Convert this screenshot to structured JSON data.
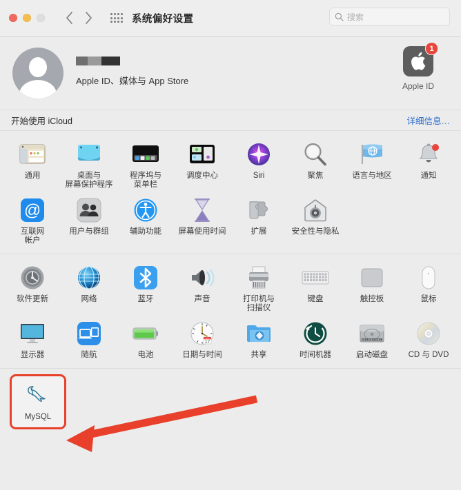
{
  "window": {
    "title": "系统偏好设置",
    "traffic_lights": [
      "close",
      "minimize",
      "zoom-disabled"
    ],
    "nav_back": "‹",
    "nav_forward": "›",
    "grid_icon": "grid-icon",
    "search": {
      "placeholder": "搜索",
      "value": "",
      "icon": "search-icon"
    }
  },
  "account": {
    "avatar_icon": "user-avatar-placeholder",
    "name_redacted": true,
    "subtitle": "Apple ID、媒体与 App Store",
    "appleid_tile": {
      "label": "Apple ID",
      "icon": "apple-logo-icon",
      "badge": "1"
    }
  },
  "icloud_banner": {
    "text": "开始使用 iCloud",
    "link": "详细信息…"
  },
  "sections": [
    {
      "name": "personal",
      "rows": [
        [
          {
            "label": "通用",
            "icon": "general-icon"
          },
          {
            "label": "桌面与\n屏幕保护程序",
            "icon": "desktop-screensaver-icon"
          },
          {
            "label": "程序坞与\n菜单栏",
            "icon": "dock-menubar-icon"
          },
          {
            "label": "调度中心",
            "icon": "mission-control-icon"
          },
          {
            "label": "Siri",
            "icon": "siri-icon"
          },
          {
            "label": "聚焦",
            "icon": "spotlight-icon"
          },
          {
            "label": "语言与地区",
            "icon": "language-region-icon"
          },
          {
            "label": "通知",
            "icon": "notifications-icon",
            "badge": true
          }
        ],
        [
          {
            "label": "互联网\n帐户",
            "icon": "internet-accounts-icon"
          },
          {
            "label": "用户与群组",
            "icon": "users-groups-icon"
          },
          {
            "label": "辅助功能",
            "icon": "accessibility-icon"
          },
          {
            "label": "屏幕使用时间",
            "icon": "screen-time-icon"
          },
          {
            "label": "扩展",
            "icon": "extensions-icon"
          },
          {
            "label": "安全性与隐私",
            "icon": "security-privacy-icon"
          }
        ]
      ]
    },
    {
      "name": "hardware",
      "rows": [
        [
          {
            "label": "软件更新",
            "icon": "software-update-icon"
          },
          {
            "label": "网络",
            "icon": "network-icon"
          },
          {
            "label": "蓝牙",
            "icon": "bluetooth-icon"
          },
          {
            "label": "声音",
            "icon": "sound-icon"
          },
          {
            "label": "打印机与\n扫描仪",
            "icon": "printers-scanners-icon"
          },
          {
            "label": "键盘",
            "icon": "keyboard-icon"
          },
          {
            "label": "触控板",
            "icon": "trackpad-icon"
          },
          {
            "label": "鼠标",
            "icon": "mouse-icon"
          }
        ],
        [
          {
            "label": "显示器",
            "icon": "displays-icon"
          },
          {
            "label": "随航",
            "icon": "sidecar-icon"
          },
          {
            "label": "电池",
            "icon": "battery-icon"
          },
          {
            "label": "日期与时间",
            "icon": "date-time-icon",
            "calendar_month": "JUL",
            "calendar_day": "17"
          },
          {
            "label": "共享",
            "icon": "sharing-icon"
          },
          {
            "label": "时间机器",
            "icon": "time-machine-icon"
          },
          {
            "label": "启动磁盘",
            "icon": "startup-disk-icon"
          },
          {
            "label": "CD 与 DVD",
            "icon": "cd-dvd-icon"
          }
        ]
      ]
    },
    {
      "name": "third-party",
      "rows": [
        [
          {
            "label": "MySQL",
            "icon": "mysql-dolphin-icon",
            "highlighted": true
          }
        ]
      ]
    }
  ],
  "annotation": {
    "type": "arrow",
    "color": "#e8402a",
    "highlight_color": "#e8402a",
    "points_to": "MySQL"
  }
}
